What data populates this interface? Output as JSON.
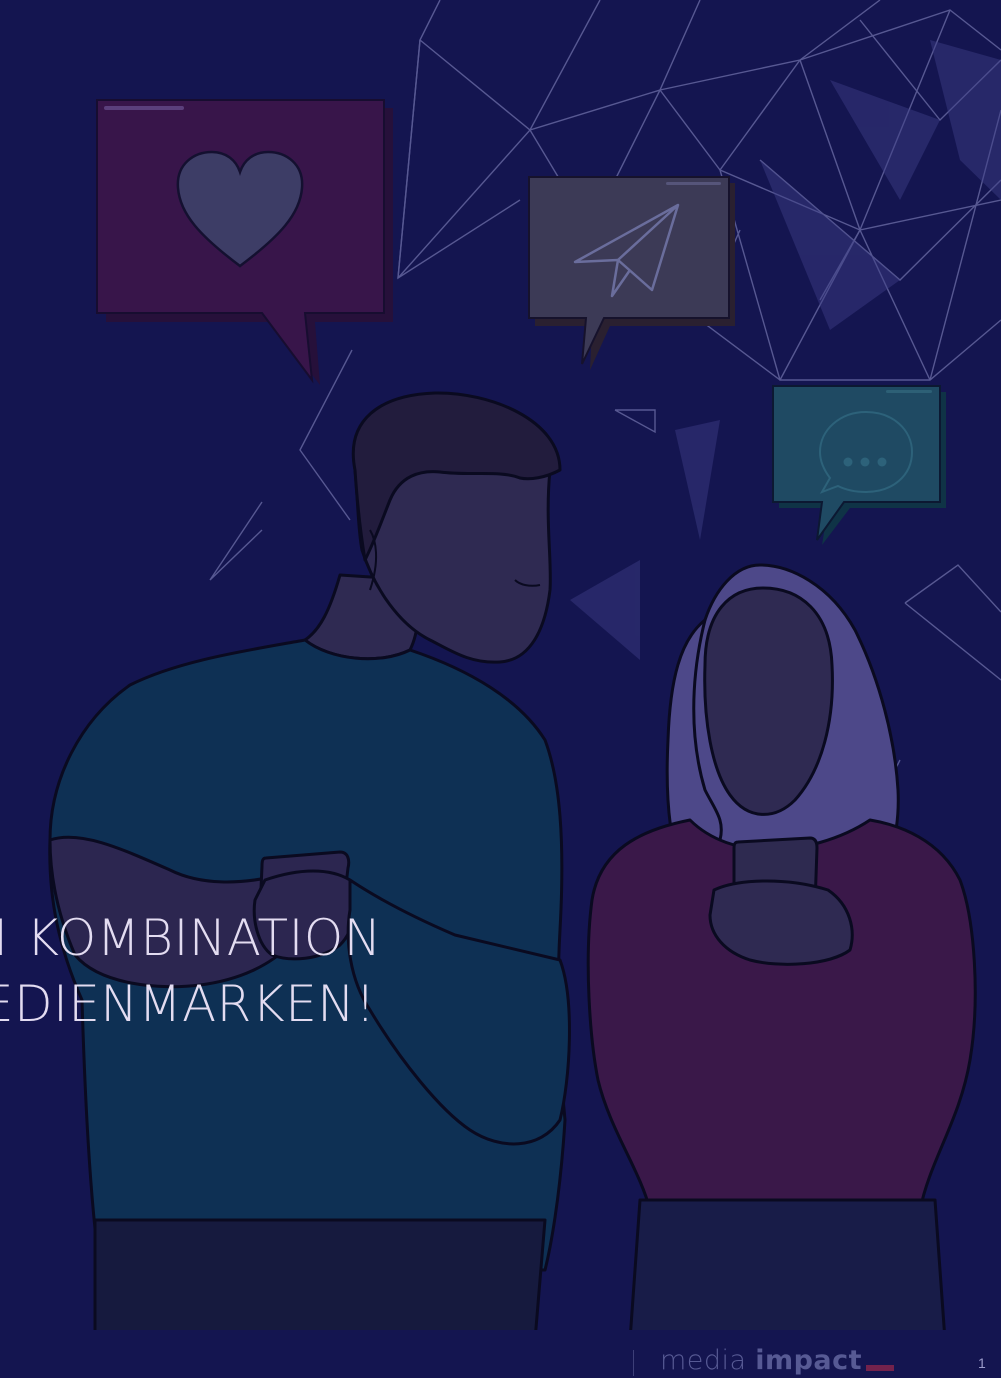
{
  "slide": {
    "headline_line1": "N KOMBINATION",
    "headline_line2": "EDIENMARKEN!",
    "brand_word1": "media",
    "brand_word2": "impact",
    "page_number": "1"
  },
  "icons": {
    "heart_bubble": "heart-icon",
    "paper_plane_bubble": "paper-plane-icon",
    "chat_bubble": "chat-dots-icon"
  },
  "colors": {
    "background": "#141550",
    "text": "#e3dcf1",
    "brand_text": "#575a94",
    "brand_accent": "#73224c"
  }
}
